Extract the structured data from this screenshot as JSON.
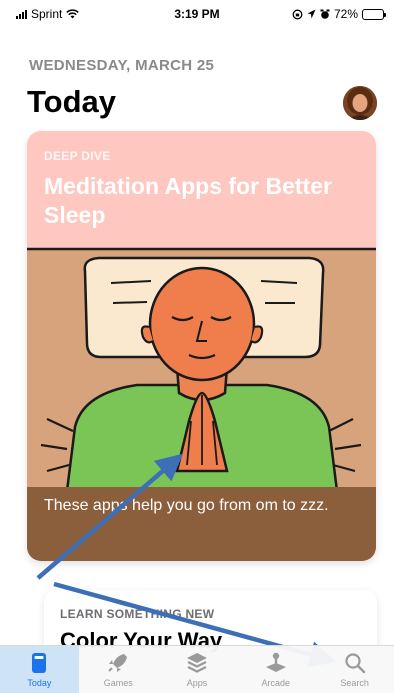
{
  "status_bar": {
    "carrier": "Sprint",
    "time": "3:19 PM",
    "battery": "72%",
    "battery_level": 0.72
  },
  "header": {
    "date": "WEDNESDAY, MARCH 25",
    "title": "Today"
  },
  "feature_card": {
    "eyebrow": "DEEP DIVE",
    "title": "Meditation Apps for Better Sleep",
    "description": "These apps help you go from om to zzz."
  },
  "second_card": {
    "eyebrow": "LEARN SOMETHING NEW",
    "title": "Color Your Way"
  },
  "tab_bar": {
    "tabs": [
      {
        "label": "Today",
        "icon": "today-icon",
        "active": true
      },
      {
        "label": "Games",
        "icon": "rocket-icon",
        "active": false
      },
      {
        "label": "Apps",
        "icon": "layers-icon",
        "active": false
      },
      {
        "label": "Arcade",
        "icon": "joystick-icon",
        "active": false
      },
      {
        "label": "Search",
        "icon": "search-icon",
        "active": false
      }
    ]
  },
  "colors": {
    "accent": "#1a73e8",
    "card_background": "#fec7c0",
    "card_footer": "#8b5e3c",
    "annotation_arrow": "#3d6fb6"
  }
}
